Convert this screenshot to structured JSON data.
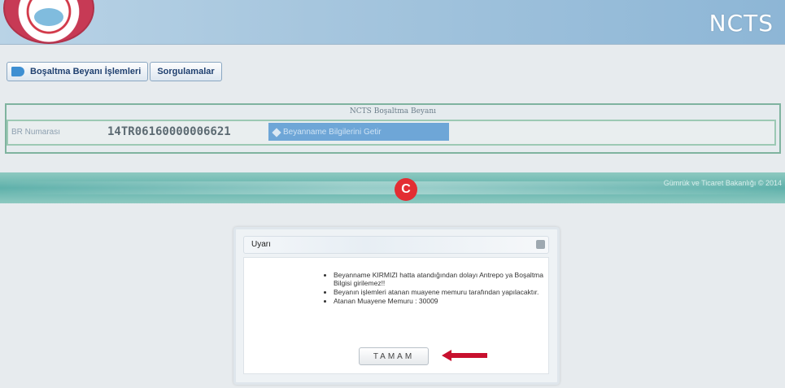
{
  "header": {
    "app_title": "NCTS"
  },
  "nav": {
    "items": [
      {
        "label": "Boşaltma Beyanı İşlemleri"
      },
      {
        "label": "Sorgulamalar"
      }
    ]
  },
  "panel": {
    "title": "NCTS Boşaltma Beyanı",
    "field_label": "BR Numarası",
    "field_value": "14TR06160000006621",
    "action_label": "Beyanname Bilgilerini Getir"
  },
  "footer": {
    "text": "Gümrük ve Ticaret Bakanlığı © 2014"
  },
  "modal": {
    "title": "Uyarı",
    "messages": [
      "Beyanname KIRMIZI hatta atandığından dolayı Antrepo ya Boşaltma Bilgisi girilemez!!",
      "Beyanın işlemleri atanan muayene memuru tarafından yapılacaktır.",
      "Atanan Muayene Memuru : 30009"
    ],
    "ok_label": "TAMAM"
  },
  "colors": {
    "header": "#a6c6de",
    "band": "#5fb1ab",
    "emblem": "#e32d33",
    "pointer": "#c8102e"
  },
  "icons": [
    "logo-icon",
    "arrow-right-icon",
    "pencil-icon",
    "close-icon",
    "pointer-arrow-icon",
    "emblem-icon"
  ]
}
